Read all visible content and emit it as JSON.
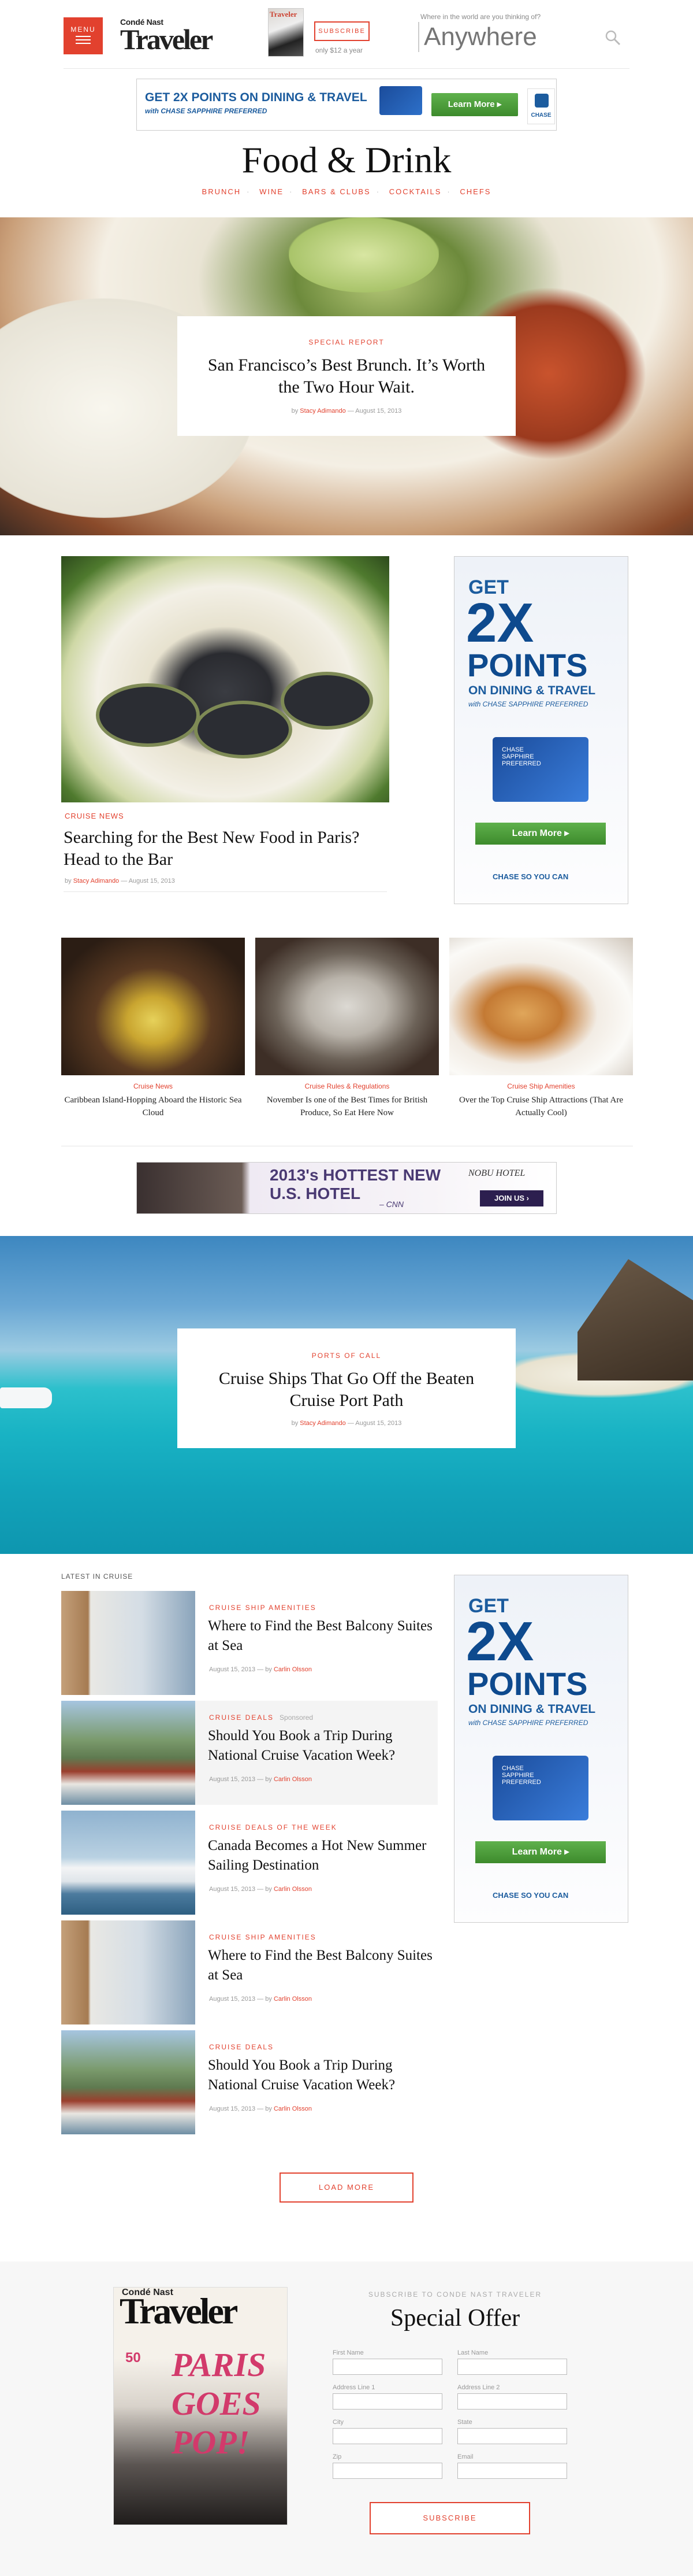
{
  "header": {
    "menu_label": "MENU",
    "logo_top": "Condé Nast",
    "logo_main": "Traveler",
    "mag_thumb_label": "Traveler",
    "subscribe_label": "SUBSCRIBE",
    "price_note": "only $12 a year",
    "search_prompt": "Where in the world are you thinking of?",
    "search_placeholder": "Anywhere"
  },
  "ad_top": {
    "headline": "GET 2X POINTS ON DINING & TRAVEL",
    "subline": "with CHASE SAPPHIRE PREFERRED",
    "cta": "Learn More ▸",
    "brand": "CHASE"
  },
  "page": {
    "title": "Food & Drink",
    "categories": [
      "BRUNCH",
      "WINE",
      "BARS & CLUBS",
      "COCKTAILS",
      "CHEFS"
    ]
  },
  "hero1": {
    "kicker": "SPECIAL REPORT",
    "title": "San Francisco’s Best Brunch. It’s Worth the Two Hour Wait.",
    "by": "by",
    "author": "Stacy Adimando",
    "date": "August 15, 2013"
  },
  "feature": {
    "kicker": "CRUISE NEWS",
    "title": "Searching for the Best New Food in Paris? Head to the Bar",
    "by": "by",
    "author": "Stacy Adimando",
    "date": "August 15, 2013"
  },
  "ad_side": {
    "get": "GET",
    "big": "2X",
    "points": "POINTS",
    "on": "ON DINING & TRAVEL",
    "with": "with CHASE SAPPHIRE PREFERRED",
    "card_line1": "CHASE",
    "card_line2": "SAPPHIRE",
    "card_line3": "PREFERRED",
    "cta": "Learn More ▸",
    "brand": "CHASE  SO YOU CAN"
  },
  "tiles": [
    {
      "kicker": "Cruise News",
      "title": "Caribbean Island-Hopping Aboard the Historic Sea Cloud"
    },
    {
      "kicker": "Cruise Rules & Regulations",
      "title": "November Is one of the Best Times for British Produce, So Eat Here Now"
    },
    {
      "kicker": "Cruise Ship Amenities",
      "title": "Over the Top Cruise Ship Attractions (That Are Actually Cool)"
    }
  ],
  "ad_mid": {
    "line1": "2013's HOTTEST NEW",
    "line2": "U.S. HOTEL",
    "source": "– CNN",
    "brand": "NOBU HOTEL",
    "cta": "JOIN US ›"
  },
  "hero2": {
    "kicker": "PORTS OF CALL",
    "title": "Cruise Ships That Go Off the Beaten Cruise Port Path",
    "by": "by",
    "author": "Stacy Adimando",
    "date": "August 15, 2013"
  },
  "latest": {
    "label": "LATEST IN CRUISE",
    "items": [
      {
        "kicker": "CRUISE SHIP AMENITIES",
        "sponsored": "",
        "title": "Where to Find the Best Balcony Suites at Sea",
        "date": "August 15, 2013",
        "by": "by",
        "author": "Carlin Olsson"
      },
      {
        "kicker": "CRUISE DEALS",
        "sponsored": "Sponsored",
        "title": "Should You Book a Trip During National Cruise Vacation Week?",
        "date": "August 15, 2013",
        "by": "by",
        "author": "Carlin Olsson"
      },
      {
        "kicker": "CRUISE DEALS OF THE WEEK",
        "sponsored": "",
        "title": "Canada Becomes a Hot New Summer Sailing Destination",
        "date": "August 15, 2013",
        "by": "by",
        "author": "Carlin Olsson"
      },
      {
        "kicker": "CRUISE SHIP AMENITIES",
        "sponsored": "",
        "title": "Where to Find the Best Balcony Suites at Sea",
        "date": "August 15, 2013",
        "by": "by",
        "author": "Carlin Olsson"
      },
      {
        "kicker": "CRUISE DEALS",
        "sponsored": "",
        "title": "Should You Book a Trip During National Cruise Vacation Week?",
        "date": "August 15, 2013",
        "by": "by",
        "author": "Carlin Olsson"
      }
    ],
    "load_more": "LOAD MORE"
  },
  "subscribe": {
    "cover_top": "Condé Nast",
    "cover_title": "Traveler",
    "cover_headline": "PARIS GOES POP!",
    "cover_number": "50",
    "kicker": "SUBSCRIBE TO CONDE NAST TRAVELER",
    "title": "Special Offer",
    "fields": {
      "first_name": "First Name",
      "last_name": "Last Name",
      "address1": "Address Line 1",
      "address2": "Address Line 2",
      "city": "City",
      "state": "State",
      "zip": "Zip",
      "email": "Email"
    },
    "button": "SUBSCRIBE"
  },
  "colors": {
    "accent": "#e2412e",
    "chase_blue": "#1c5c9e",
    "cta_green": "#4a9e3a"
  }
}
